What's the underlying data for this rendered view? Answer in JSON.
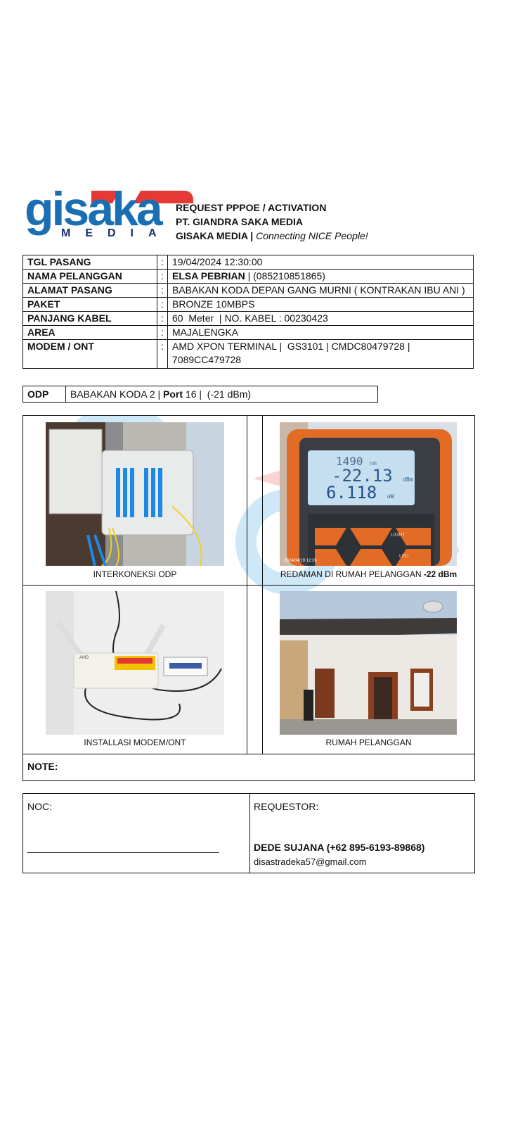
{
  "header": {
    "logo_text": "gisaka",
    "logo_sub": "MEDIA",
    "line1": "REQUEST PPPOE / ACTIVATION",
    "line2": "PT. GIANDRA SAKA MEDIA",
    "line3_bold": "GISAKA MEDIA |",
    "line3_italic": "Connecting NICE People!"
  },
  "info": {
    "colon": ":",
    "rows": [
      {
        "label": "TGL PASANG",
        "value": "19/04/2024 12:30:00"
      },
      {
        "label": "NAMA PELANGGAN",
        "value_bold": "ELSA PEBRIAN",
        "value": " | (085210851865)"
      },
      {
        "label": "ALAMAT PASANG",
        "value": "BABAKAN KODA DEPAN GANG MURNI ( KONTRAKAN IBU ANI )"
      },
      {
        "label": "PAKET",
        "value": "BRONZE 10MBPS"
      },
      {
        "label": "PANJANG KABEL",
        "value": "60  Meter  | NO. KABEL : 00230423"
      },
      {
        "label": "AREA",
        "value": "MAJALENGKA"
      },
      {
        "label": "MODEM / ONT",
        "value": "AMD XPON TERMINAL |  GS3101 | CMDC80479728 |",
        "value2": "7089CC479728"
      }
    ]
  },
  "odp": {
    "label": "ODP",
    "value_pre": "BABAKAN KODA 2 | ",
    "port_label": "Port",
    "value_post": " 16 |  (-21 dBm)"
  },
  "photos": {
    "p1_caption": "INTERKONEKSI ODP",
    "p2_caption": "REDAMAN DI RUMAH PELANGGAN ",
    "p2_caption_bold": "-22 dBm",
    "p3_caption": "INSTALLASI MODEM/ONT",
    "p4_caption": "RUMAH PELANGGAN",
    "meter_line1": "1490",
    "meter_line1_unit": "nm",
    "meter_line2": "-22.13",
    "meter_line2_unit": "dBm",
    "meter_line3": "6.118",
    "meter_line3_unit": "uW",
    "meter_btn": "LIGHT",
    "meter_btn2": "LED",
    "meter_stamp": "2024/04/19 12:26",
    "modem_brand": "AMD"
  },
  "note_label": "NOTE:",
  "signature": {
    "noc_label": "NOC:",
    "noc_line": "___________________________________",
    "requestor_label": "REQUESTOR:",
    "requestor_name": "DEDE SUJANA (+62 895-6193-89868)",
    "requestor_email": "disastradeka57@gmail.com"
  }
}
